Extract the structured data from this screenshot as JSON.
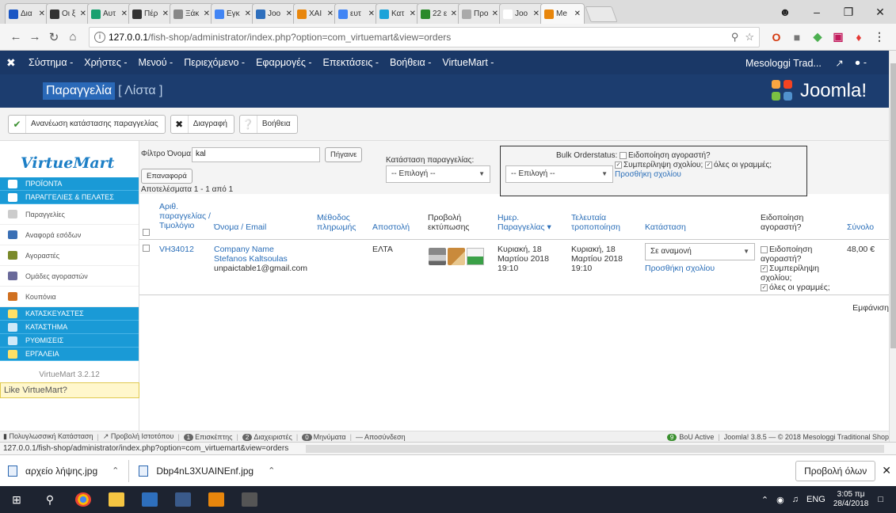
{
  "browser": {
    "tabs": [
      {
        "label": "Δια",
        "color": "#1a56c4",
        "active": false
      },
      {
        "label": "Οι ξ",
        "color": "#333333",
        "active": false
      },
      {
        "label": "Αυτ",
        "color": "#19a070",
        "active": false
      },
      {
        "label": "Πέρ",
        "color": "#333333",
        "active": false
      },
      {
        "label": "Ξάκ",
        "color": "#888888",
        "active": false
      },
      {
        "label": "Εγκ",
        "color": "#4285f4",
        "active": false
      },
      {
        "label": "Joo",
        "color": "#2e6fbd",
        "active": false
      },
      {
        "label": "XAI",
        "color": "#e8860c",
        "active": false
      },
      {
        "label": "ευτ",
        "color": "#4285f4",
        "active": false
      },
      {
        "label": "Κατ",
        "color": "#1ba3d9",
        "active": false
      },
      {
        "label": "22 ε",
        "color": "#2a8a2a",
        "active": false
      },
      {
        "label": "Προ",
        "color": "#aaaaaa",
        "active": false
      },
      {
        "label": "Joo",
        "color": "#ffffff",
        "active": false
      },
      {
        "label": "Me",
        "color": "#e8860c",
        "active": true
      }
    ],
    "address_host": "127.0.0.1",
    "address_path": "/fish-shop/administrator/index.php?option=com_virtuemart&view=orders"
  },
  "joomla_menu": {
    "items": [
      "Σύστημα -",
      "Χρήστες -",
      "Μενού -",
      "Περιεχόμενο -",
      "Εφαρμογές -",
      "Επεκτάσεις -",
      "Βοήθεια -",
      "VirtueMart -"
    ],
    "site_name": "Mesologgi Trad...",
    "user_caret": "-"
  },
  "header": {
    "title": "Παραγγελία",
    "subtitle": "[ Λίστα ]",
    "brand": "Joomla!"
  },
  "toolbar": {
    "refresh_label": "Ανανέωση κατάστασης παραγγελίας",
    "delete_label": "Διαγραφή",
    "help_label": "Βοήθεια"
  },
  "sidebar": {
    "logo_text": "VirtueMart",
    "items": [
      {
        "label": "ΠΡΟΪΟΝΤΑ",
        "type": "cat",
        "color": "#ffffff"
      },
      {
        "label": "ΠΑΡΑΓΓΕΛΙΕΣ & ΠΕΛΑΤΕΣ",
        "type": "cat",
        "color": "#ffffff"
      },
      {
        "label": "Παραγγελίες",
        "type": "sub",
        "color": "#cccccc"
      },
      {
        "label": "Αναφορά εσόδων",
        "type": "sub",
        "color": "#3a6fb5"
      },
      {
        "label": "Αγοραστές",
        "type": "sub",
        "color": "#7a8a2a"
      },
      {
        "label": "Ομάδες αγοραστών",
        "type": "sub",
        "color": "#6a6a9a"
      },
      {
        "label": "Κουπόνια",
        "type": "sub",
        "color": "#d07020"
      },
      {
        "label": "ΚΑΤΑΣΚΕΥΑΣΤΕΣ",
        "type": "cat",
        "color": "#ffe066"
      },
      {
        "label": "ΚΑΤΑΣΤΗΜΑ",
        "type": "cat",
        "color": "#cfe9f8"
      },
      {
        "label": "ΡΥΘΜΙΣΕΙΣ",
        "type": "cat",
        "color": "#cfe9f8"
      },
      {
        "label": "ΕΡΓΑΛΕΙΑ",
        "type": "cat",
        "color": "#ffe066"
      }
    ],
    "version": "VirtueMart 3.2.12",
    "like": "Like VirtueMart?"
  },
  "filters": {
    "name_label": "Φίλτρο Όνομα:",
    "name_value": "kal",
    "go_button": "Πήγαινε",
    "reset_button": "Επαναφορά",
    "results": "Αποτελέσματα 1 - 1 από 1",
    "status_label": "Κατάσταση παραγγελίας:",
    "status_select": "-- Επιλογή --"
  },
  "bulk": {
    "label": "Bulk Orderstatus:",
    "notify": "Ειδοποίηση αγοραστή?",
    "select": "-- Επιλογή --",
    "include_comment": "Συμπερίληψη σχολίου;",
    "all_lines": "όλες οι γραμμές;",
    "add_comment": "Προσθήκη σχολίου"
  },
  "table": {
    "headers": {
      "order_number": "Αριθ. παραγγελίας / Τιμολόγιο",
      "name_email": "Όνομα / Email",
      "payment": "Μέθοδος πληρωμής",
      "shipment": "Αποστολή",
      "print": "Προβολή εκτύπωσης",
      "date": "Ημερ. Παραγγελίας",
      "modified": "Τελευταία τροποποίηση",
      "status": "Κατάσταση",
      "notify": "Ειδοποίηση αγοραστή?",
      "total": "Σύνολο"
    },
    "rows": [
      {
        "order_number": "VH34012",
        "name": "Company Name Stefanos Kaltsoulas",
        "email": "unpaictable1@gmail.com",
        "payment": "",
        "shipment": "ΕΛΤΑ",
        "date": "Κυριακή, 18 Μαρτίου 2018 19:10",
        "modified": "Κυριακή, 18 Μαρτίου 2018 19:10",
        "status": "Σε αναμονή",
        "add_comment": "Προσθήκη σχολίου",
        "notify": "Ειδοποίηση αγοραστή?",
        "include_comment": "Συμπερίληψη σχολίου;",
        "all_lines": "όλες οι γραμμές;",
        "total": "48,00 €"
      }
    ],
    "show_label": "Εμφάνιση"
  },
  "statusbar": {
    "multilang": "Πολυγλωσσική Κατάσταση",
    "view_site": "Προβολή Ιστοτόπου",
    "visitors_count": "1",
    "visitors": "Επισκέπτης",
    "admins_count": "2",
    "admins": "Διαχειριστές",
    "messages_count": "0",
    "messages": "Μηνύματα",
    "logout": "Αποσύνδεση",
    "bou_count": "9",
    "bou": "BoU Active",
    "footer": "Joomla! 3.8.5 — © 2018 Mesologgi Traditional Shop"
  },
  "url_status": "127.0.0.1/fish-shop/administrator/index.php?option=com_virtuemart&view=orders",
  "downloads": {
    "items": [
      "αρχείο λήψης.jpg",
      "Dbp4nL3XUAINEnf.jpg"
    ],
    "show_all": "Προβολή όλων"
  },
  "taskbar": {
    "lang": "ENG",
    "time": "3:05 πμ",
    "date": "28/4/2018"
  }
}
